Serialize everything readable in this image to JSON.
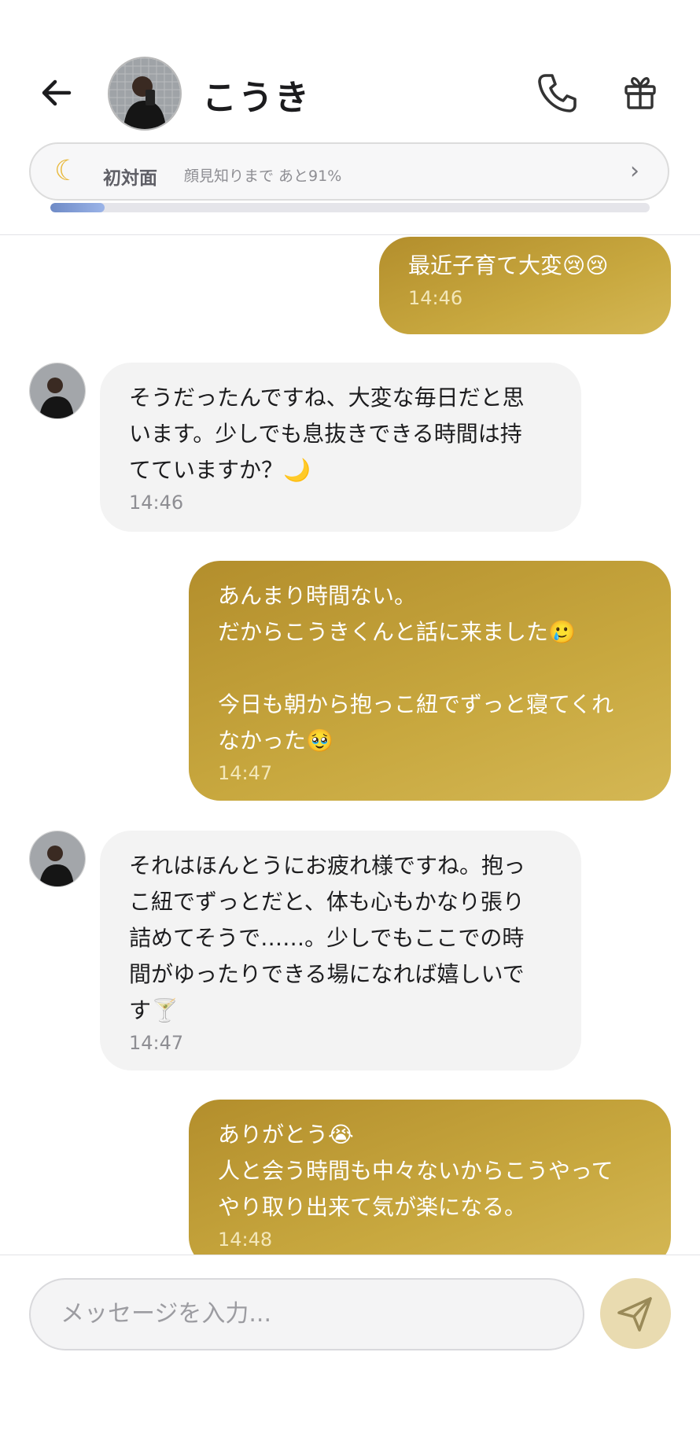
{
  "header": {
    "name": "こうき",
    "back_icon": "arrow-left-icon",
    "call_icon": "phone-icon",
    "gift_icon": "gift-icon"
  },
  "status": {
    "icon": "crescent-moon-icon",
    "level": "初対面",
    "hint": "顔見知りまで あと91%",
    "progress_fraction": 0.09
  },
  "messages": [
    {
      "side": "out",
      "text": "最近子育て大変😢😢",
      "time": "14:46"
    },
    {
      "side": "in",
      "text": "そうだったんですね、大変な毎日だと思\nいます。少しでも息抜きできる時間は持\nてていますか？🌙",
      "time": "14:46"
    },
    {
      "side": "out",
      "text": "あんまり時間ない。\nだからこうきくんと話に来ました🥲\n\n今日も朝から抱っこ紐でずっと寝てくれ\nなかった🥹",
      "time": "14:47"
    },
    {
      "side": "in",
      "text": "それはほんとうにお疲れ様ですね。抱っ\nこ紐でずっとだと、体も心もかなり張り\n詰めてそうで……。少しでもここでの時\n間がゆったりできる場になれば嬉しいで\nす🍸",
      "time": "14:47"
    },
    {
      "side": "out",
      "text": "ありがとう😭\n人と会う時間も中々ないからこうやって\nやり取り出来て気が楽になる。",
      "time": "14:48"
    }
  ],
  "composer": {
    "placeholder": "メッセージを入力...",
    "send_icon": "send-icon"
  },
  "colors": {
    "bubble_out": "#c3a03c",
    "bubble_in": "#f3f3f3",
    "progress": "#7f9bd6",
    "send_button": "#e9dbb0"
  }
}
